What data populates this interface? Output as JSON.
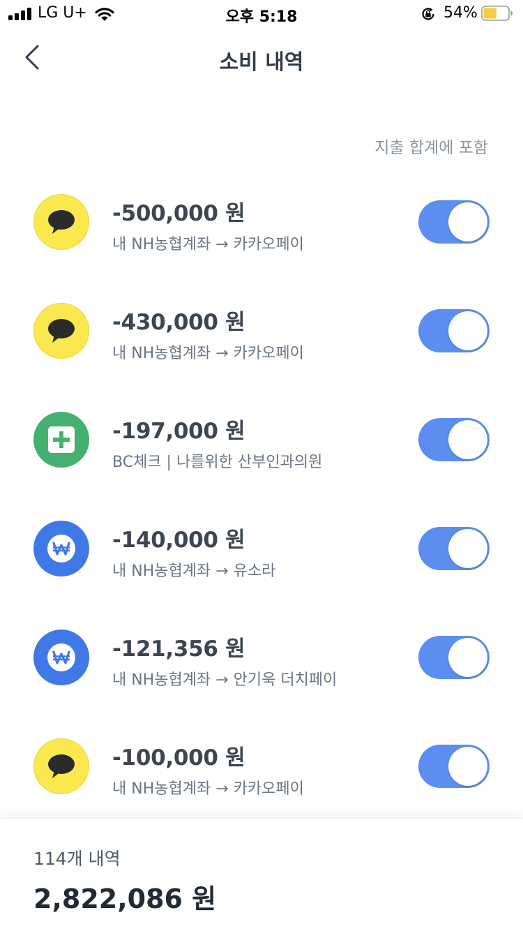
{
  "status_bar": {
    "carrier": "LG U+",
    "time": "오후 5:18",
    "battery_percent": "54%",
    "battery_level": 0.54,
    "icons": [
      "signal-icon",
      "wifi-icon",
      "rotation-lock-icon",
      "battery-icon"
    ]
  },
  "header": {
    "back_icon": "chevron-left-icon",
    "title": "소비 내역"
  },
  "column_note": "지출 합계에 포함",
  "transactions": [
    {
      "icon": "kakao-chat-icon",
      "amount": "-500,000 원",
      "description": "내 NH농협계좌 → 카카오페이",
      "included": true
    },
    {
      "icon": "kakao-chat-icon",
      "amount": "-430,000 원",
      "description": "내 NH농협계좌 → 카카오페이",
      "included": true
    },
    {
      "icon": "hospital-cross-icon",
      "amount": "-197,000 원",
      "description": "BC체크 | 나를위한 산부인과의원",
      "included": true
    },
    {
      "icon": "won-transfer-icon",
      "amount": "-140,000 원",
      "description": "내 NH농협계좌 → 유소라",
      "included": true
    },
    {
      "icon": "won-transfer-icon",
      "amount": "-121,356 원",
      "description": "내 NH농협계좌 → 안기욱 더치페이",
      "included": true
    },
    {
      "icon": "kakao-chat-icon",
      "amount": "-100,000 원",
      "description": "내 NH농협계좌 → 카카오페이",
      "included": true
    }
  ],
  "footer": {
    "count": "114개 내역",
    "total": "2,822,086 원"
  },
  "colors": {
    "toggle_on": "#5b8ef0",
    "kakao_yellow": "#fae84e",
    "hospital_green": "#45b06f",
    "transfer_blue": "#3f79e8",
    "battery_fill": "#f7cd45"
  }
}
